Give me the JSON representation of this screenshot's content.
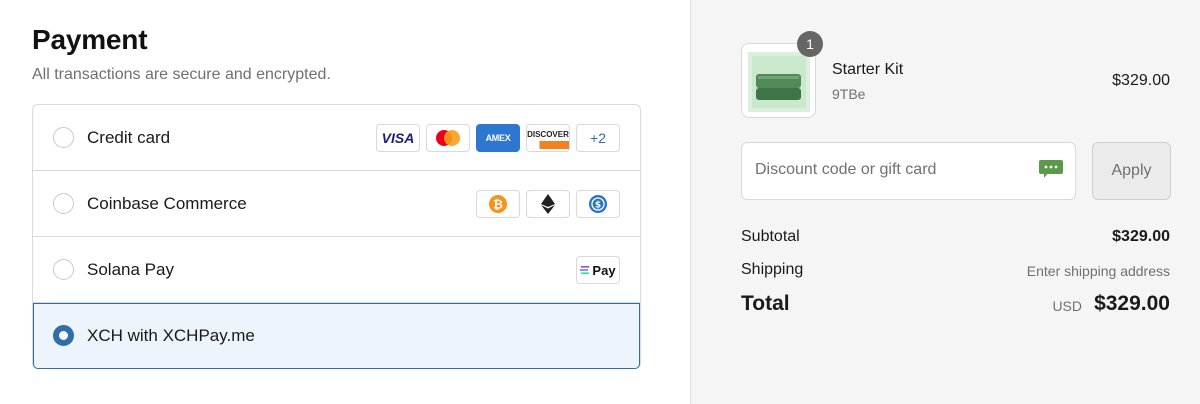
{
  "payment": {
    "title": "Payment",
    "subtitle": "All transactions are secure and encrypted.",
    "methods": [
      {
        "label": "Credit card",
        "selected": false,
        "badges": [
          "VISA",
          "Mastercard",
          "AMEX",
          "DISCOVER",
          "+2"
        ]
      },
      {
        "label": "Coinbase Commerce",
        "selected": false,
        "badges": [
          "bitcoin-icon",
          "ethereum-icon",
          "usdc-icon"
        ]
      },
      {
        "label": "Solana Pay",
        "selected": false,
        "badges": [
          "Pay"
        ]
      },
      {
        "label": "XCH with XCHPay.me",
        "selected": true,
        "badges": []
      }
    ]
  },
  "summary": {
    "item": {
      "name": "Starter Kit",
      "variant": "9TBe",
      "price": "$329.00",
      "quantity": "1"
    },
    "discount": {
      "placeholder": "Discount code or gift card",
      "apply_label": "Apply"
    },
    "subtotal_label": "Subtotal",
    "subtotal_value": "$329.00",
    "shipping_label": "Shipping",
    "shipping_value": "Enter shipping address",
    "total_label": "Total",
    "total_currency": "USD",
    "total_value": "$329.00"
  },
  "colors": {
    "accent": "#2f6ea8",
    "selected_bg": "#eef4fb",
    "sidebar_bg": "#f5f5f5"
  }
}
